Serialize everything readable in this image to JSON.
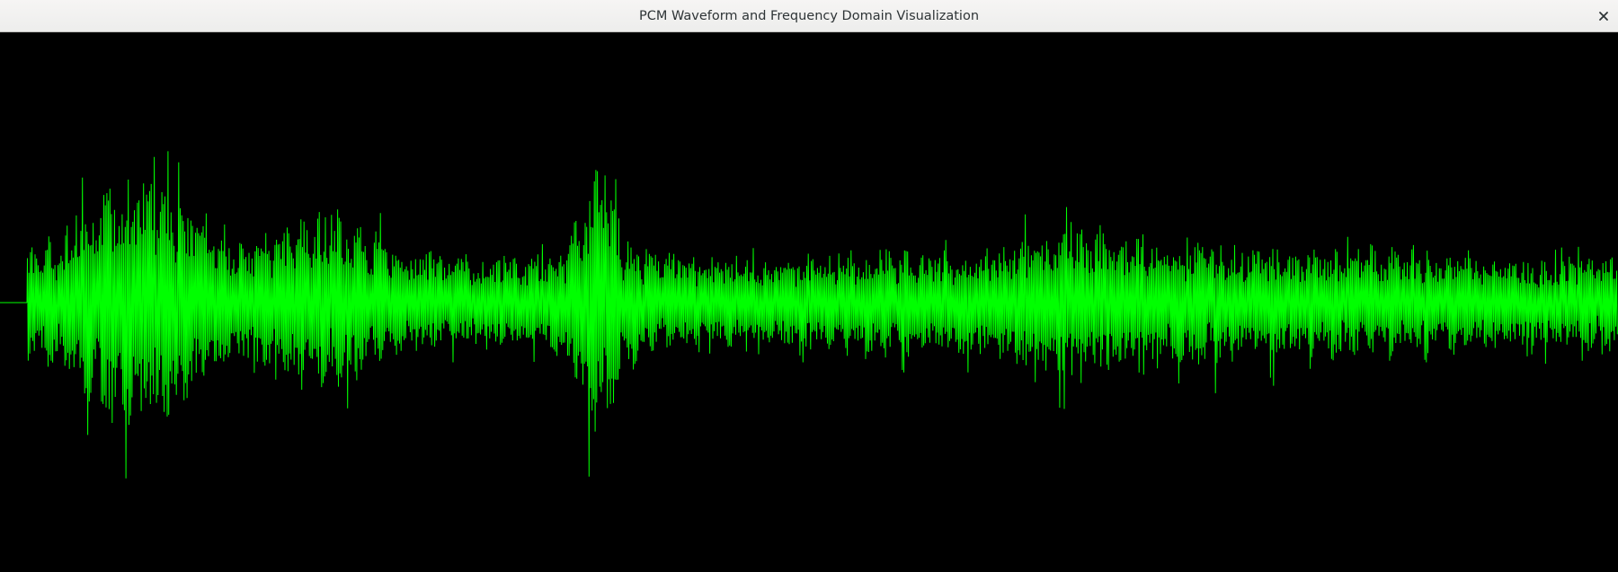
{
  "window": {
    "title": "PCM Waveform and Frequency Domain Visualization"
  },
  "icons": {
    "close": "close-icon"
  },
  "colors": {
    "background": "#000000",
    "waveform": "#00ff00",
    "titlebar": "#f6f5f4",
    "title_text": "#2e3436"
  }
}
